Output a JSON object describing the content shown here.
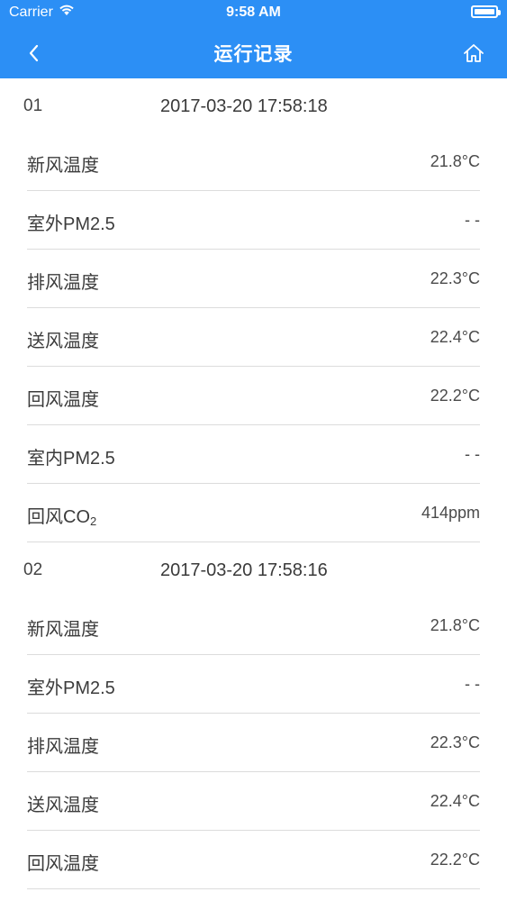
{
  "status_bar": {
    "carrier": "Carrier",
    "time": "9:58 AM",
    "battery_level": 1.0
  },
  "nav": {
    "title": "运行记录",
    "back_icon": "chevron-left-icon",
    "home_icon": "home-icon"
  },
  "colors": {
    "primary": "#2c8ff5",
    "divider": "#dcdcdc",
    "background": "#ffffff"
  },
  "records": [
    {
      "index": "01",
      "timestamp": "2017-03-20 17:58:18",
      "items": [
        {
          "label": "新风温度",
          "value": "21.8°C"
        },
        {
          "label": "室外PM2.5",
          "value": "- -"
        },
        {
          "label": "排风温度",
          "value": "22.3°C"
        },
        {
          "label": "送风温度",
          "value": "22.4°C"
        },
        {
          "label": "回风温度",
          "value": "22.2°C"
        },
        {
          "label": "室内PM2.5",
          "value": "- -"
        },
        {
          "label": "回风CO",
          "label_sub": "2",
          "value": "414ppm"
        }
      ]
    },
    {
      "index": "02",
      "timestamp": "2017-03-20 17:58:16",
      "items": [
        {
          "label": "新风温度",
          "value": "21.8°C"
        },
        {
          "label": "室外PM2.5",
          "value": "- -"
        },
        {
          "label": "排风温度",
          "value": "22.3°C"
        },
        {
          "label": "送风温度",
          "value": "22.4°C"
        },
        {
          "label": "回风温度",
          "value": "22.2°C"
        }
      ]
    }
  ]
}
